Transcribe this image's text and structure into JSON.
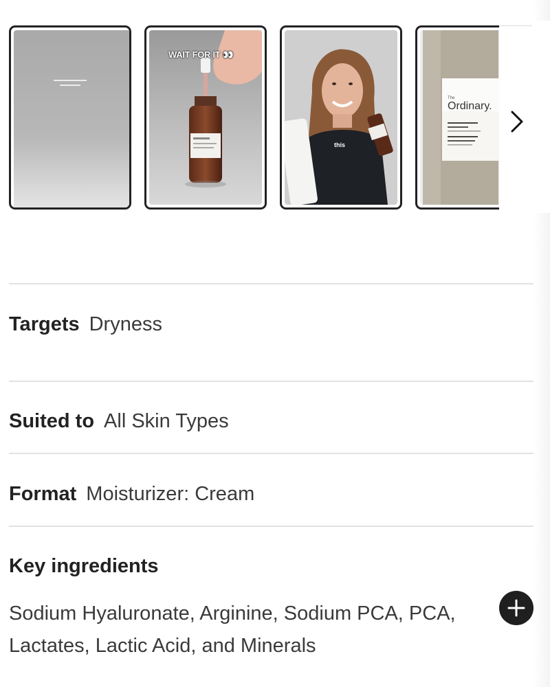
{
  "carousel": {
    "thumbnails": [
      {
        "caption": "",
        "overlay_text": ""
      },
      {
        "caption": "WAIT FOR IT 👀",
        "overlay_text": ""
      },
      {
        "caption": "",
        "overlay_text": "this"
      },
      {
        "caption": "",
        "overlay_text": ""
      }
    ],
    "product_label": {
      "the": "The",
      "brand": "Ordinary.",
      "line1": "Natural Moisturizing",
      "line2": "Factors + HA",
      "line3": "Facteurs Naturels",
      "line4": "d'Hydratation + HA"
    },
    "next_icon": "chevron-right-icon"
  },
  "details": {
    "targets": {
      "label": "Targets",
      "value": "Dryness"
    },
    "suited_to": {
      "label": "Suited to",
      "value": "All Skin Types"
    },
    "format": {
      "label": "Format",
      "value": "Moisturizer: Cream"
    },
    "key_ingredients": {
      "label": "Key ingredients",
      "value": "Sodium Hyaluronate, Arginine, Sodium PCA, PCA, Lactates, Lactic Acid, and Minerals",
      "expand_icon": "plus-icon"
    }
  },
  "colors": {
    "text_dark": "#222222",
    "divider": "#e2e2e2",
    "button_bg": "#1f1f1f"
  }
}
